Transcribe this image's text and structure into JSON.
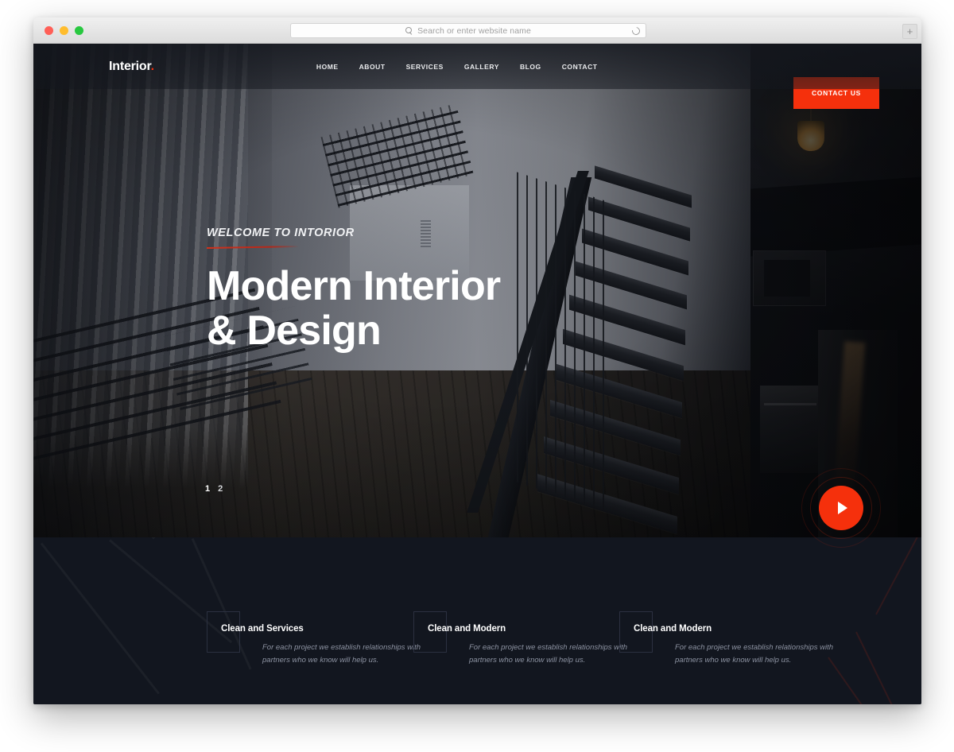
{
  "browser": {
    "traffic_lights": [
      "close",
      "minimize",
      "maximize"
    ],
    "address_placeholder": "Search or enter website name",
    "search_icon": "search-icon",
    "reload_icon": "reload-icon",
    "newtab_label": "+"
  },
  "site": {
    "logo": {
      "text": "Interior",
      "dot": "."
    },
    "nav": [
      {
        "label": "HOME"
      },
      {
        "label": "ABOUT"
      },
      {
        "label": "SERVICES"
      },
      {
        "label": "GALLERY"
      },
      {
        "label": "BLOG"
      },
      {
        "label": "CONTACT"
      }
    ],
    "cta": {
      "label": "CONTACT US"
    },
    "hero": {
      "eyebrow": "WELCOME TO INTORIOR",
      "title_line1": "Modern Interior",
      "title_line2": "& Design",
      "slides": [
        {
          "label": "1"
        },
        {
          "label": "2"
        }
      ],
      "play_button_label": "play-video"
    },
    "features": [
      {
        "title": "Clean and Services",
        "desc": "For each project we establish relationships with partners who we know will help us."
      },
      {
        "title": "Clean and Modern",
        "desc": "For each project we establish relationships with partners who we know will help us."
      },
      {
        "title": "Clean and Modern",
        "desc": "For each project we establish relationships with partners who we know will help us."
      }
    ]
  },
  "colors": {
    "accent": "#f5300c",
    "dark_section": "#12161f",
    "text_light": "#ffffff",
    "text_muted": "#8d93a2"
  }
}
